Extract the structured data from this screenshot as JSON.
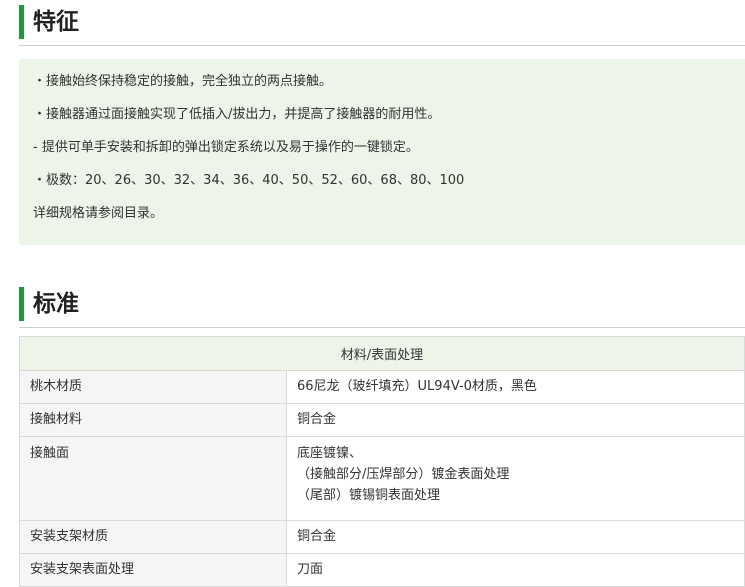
{
  "features": {
    "heading": "特征",
    "lines": [
      "・接触始终保持稳定的接触，完全独立的两点接触。",
      "・接触器通过面接触实现了低插入/拔出力，并提高了接触器的耐用性。",
      "- 提供可单手安装和拆卸的弹出锁定系统以及易于操作的一键锁定。",
      "・极数：20、26、30、32、34、36、40、50、52、60、68、80、100",
      "详细规格请参阅目录。"
    ]
  },
  "standard": {
    "heading": "标准",
    "column_header": "材料/表面处理",
    "rows": [
      {
        "label": "桃木材质",
        "value": "66尼龙（玻纤填充）UL94V-0材质，黑色"
      },
      {
        "label": "接触材料",
        "value": "铜合金"
      },
      {
        "label": "接触面",
        "lines": [
          "底座镀镍、",
          "（接触部分/压焊部分）镀金表面处理",
          "（尾部）镀锡铜表面处理"
        ]
      },
      {
        "label": "安装支架材质",
        "value": "铜合金"
      },
      {
        "label": "安装支架表面处理",
        "value": "刀面"
      }
    ]
  }
}
